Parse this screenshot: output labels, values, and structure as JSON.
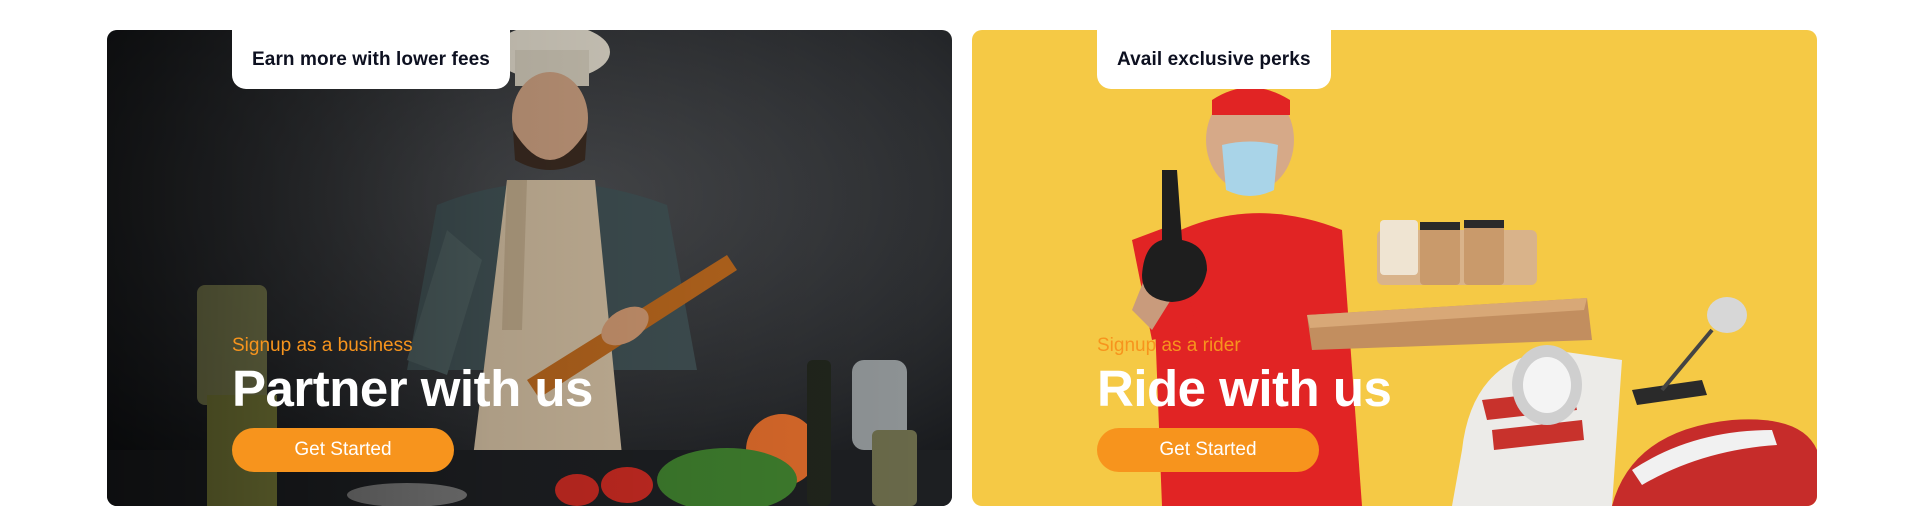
{
  "cards": [
    {
      "tag": "Earn more with lower fees",
      "eyebrow": "Signup as a business",
      "headline": "Partner with us",
      "cta": "Get Started",
      "photo": "chef-holding-rolling-pin"
    },
    {
      "tag": "Avail exclusive perks",
      "eyebrow": "Signup as a rider",
      "headline": "Ride with us",
      "cta": "Get Started",
      "photo": "delivery-rider-thumbs-up"
    }
  ],
  "colors": {
    "accent": "#f7941d",
    "tag_text": "#0d1020",
    "headline": "#ffffff",
    "business_bg": "#2b2d30",
    "rider_bg": "#f5c945"
  }
}
